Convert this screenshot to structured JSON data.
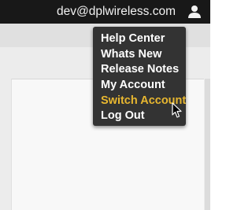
{
  "header": {
    "account_email": "dev@dplwireless.com",
    "user_icon": "user-icon"
  },
  "menu": {
    "items": [
      {
        "label": "Help Center"
      },
      {
        "label": "Whats New"
      },
      {
        "label": "Release Notes"
      },
      {
        "label": "My Account"
      },
      {
        "label": "Switch Account",
        "highlighted": true
      },
      {
        "label": "Log Out"
      }
    ],
    "highlight_color": "#e8b730"
  },
  "colors": {
    "topbar": "#181818",
    "menu_bg": "#333333",
    "menu_text": "#ffffff"
  }
}
